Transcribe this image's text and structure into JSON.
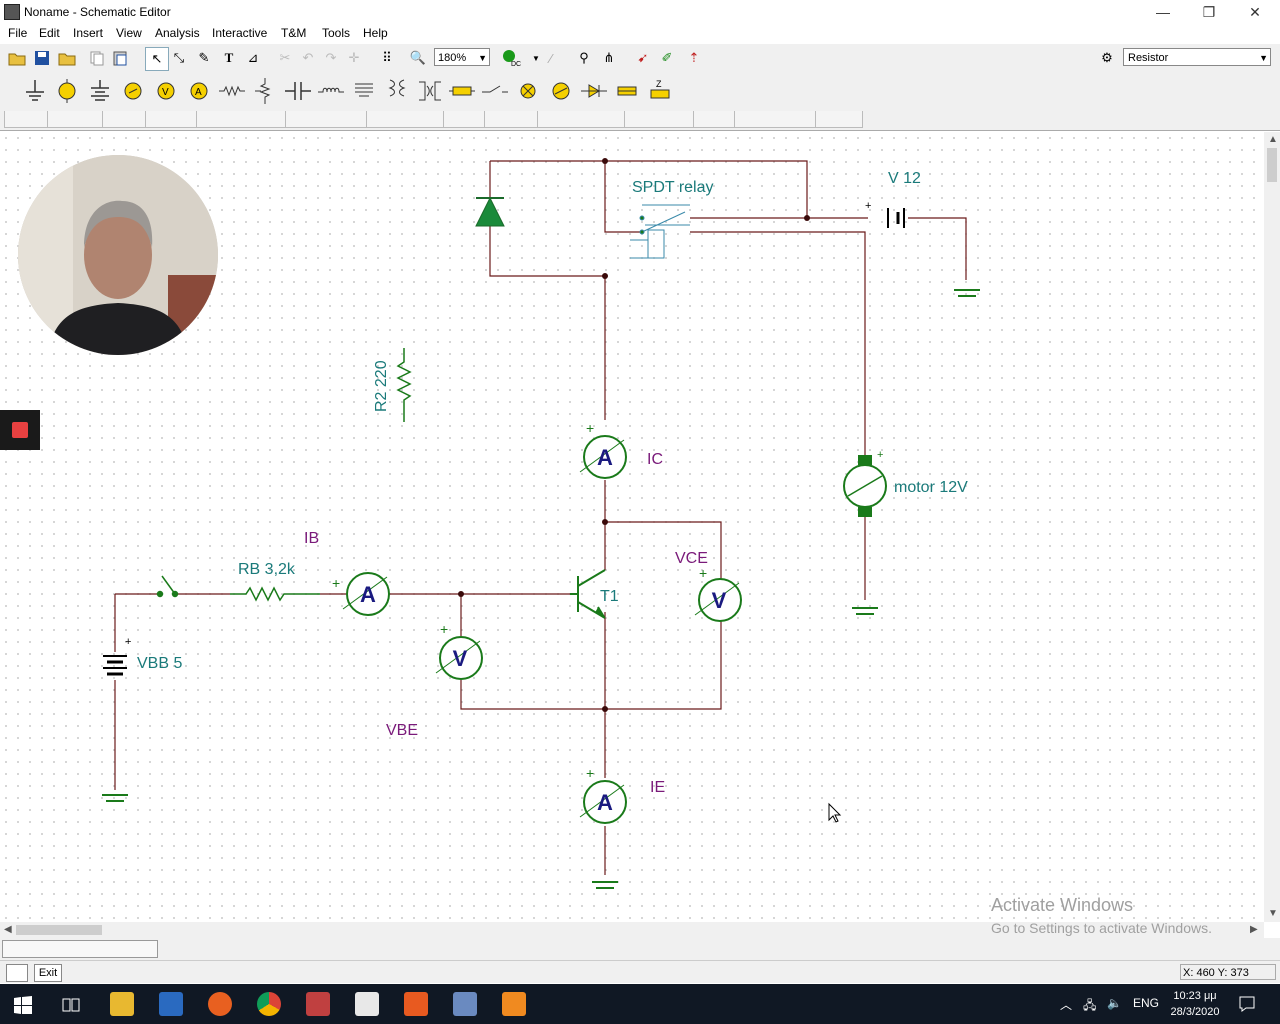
{
  "window": {
    "title": "Noname - Schematic Editor",
    "minimize": "—",
    "maximize": "❐",
    "close": "✕"
  },
  "menu": [
    "File",
    "Edit",
    "Insert",
    "View",
    "Analysis",
    "Interactive",
    "T&M",
    "Tools",
    "Help"
  ],
  "toolbar": {
    "zoom": "180%",
    "component_select": "Resistor"
  },
  "schematic": {
    "labels": {
      "spdt": "SPDT relay",
      "v12": "V 12",
      "r2": "R2 220",
      "ic": "IC",
      "motor": "motor 12V",
      "ib": "IB",
      "rb": "RB 3,2k",
      "vce": "VCE",
      "t1": "T1",
      "vbb": "VBB 5",
      "vbe": "VBE",
      "ie": "IE"
    },
    "meters": {
      "ammeter": "A",
      "voltmeter": "V",
      "plus": "+"
    }
  },
  "status": {
    "exit": "Exit",
    "coords": "X: 460  Y: 373"
  },
  "watermark": {
    "line1": "Activate Windows",
    "line2": "Go to Settings to activate Windows."
  },
  "tray": {
    "lang": "ENG",
    "time": "10:23 μμ",
    "date": "28/3/2020"
  },
  "colors": {
    "wire": "#6b1a1a",
    "component": "#1a7a1a",
    "label": "#1a7a7a",
    "meter_text": "#1a1a80",
    "annotation": "#7a1a7a"
  }
}
